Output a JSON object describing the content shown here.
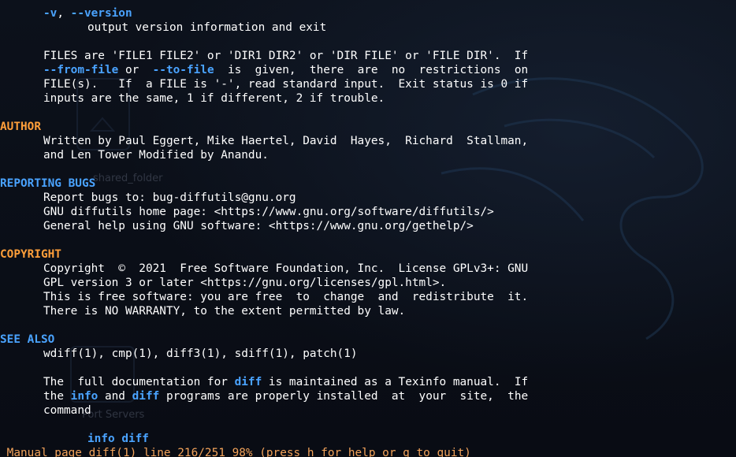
{
  "desktop": {
    "folder_label": "shared_folder",
    "servers_label": "Port Servers"
  },
  "man": {
    "opt_v_short": "-v",
    "opt_v_sep": ", ",
    "opt_v_long": "--version",
    "opt_v_desc": "output version information and exit",
    "files_1": "FILES are 'FILE1 FILE2' or 'DIR1 DIR2' or 'DIR FILE' or 'FILE DIR'.  If",
    "files_2a": "--from-file",
    "files_2b": " or  ",
    "files_2c": "--to-file",
    "files_2d": "  is  given,  there  are  no  restrictions  on",
    "files_3": "FILE(s).   If  a FILE is '-', read standard input.  Exit status is 0 if",
    "files_4": "inputs are the same, 1 if different, 2 if trouble.",
    "author_heading": "AUTHOR",
    "author_1": "Written by Paul Eggert, Mike Haertel, David  Hayes,  Richard  Stallman,",
    "author_2": "and Len Tower Modified by Anandu.",
    "bugs_heading": "REPORTING BUGS",
    "bugs_1": "Report bugs to: bug-diffutils@gnu.org",
    "bugs_2": "GNU diffutils home page: <https://www.gnu.org/software/diffutils/>",
    "bugs_3": "General help using GNU software: <https://www.gnu.org/gethelp/>",
    "copyright_heading": "COPYRIGHT",
    "copyright_1": "Copyright  ©  2021  Free Software Foundation, Inc.  License GPLv3+: GNU",
    "copyright_2": "GPL version 3 or later <https://gnu.org/licenses/gpl.html>.",
    "copyright_3": "This is free software: you are free  to  change  and  redistribute  it.",
    "copyright_4": "There is NO WARRANTY, to the extent permitted by law.",
    "seealso_heading": "SEE ALSO",
    "seealso_1": "wdiff(1), cmp(1), diff3(1), sdiff(1), patch(1)",
    "doc_1a": "The  full documentation for ",
    "doc_1b": "diff",
    "doc_1c": " is maintained as a Texinfo manual.  If",
    "doc_2a": "the ",
    "doc_2b": "info",
    "doc_2c": " and ",
    "doc_2d": "diff",
    "doc_2e": " programs are properly installed  at  your  site,  the",
    "doc_3": "command",
    "doc_4": "info diff"
  },
  "status_bar": {
    "text": " Manual page diff(1) line 216/251 98% (press h for help or q to quit)"
  },
  "colors": {
    "background": "#0a0e17",
    "text": "#ffffff",
    "highlight_blue": "#4aa3ff",
    "heading_orange": "#ff9f3a",
    "status_orange": "#f3a35a"
  }
}
